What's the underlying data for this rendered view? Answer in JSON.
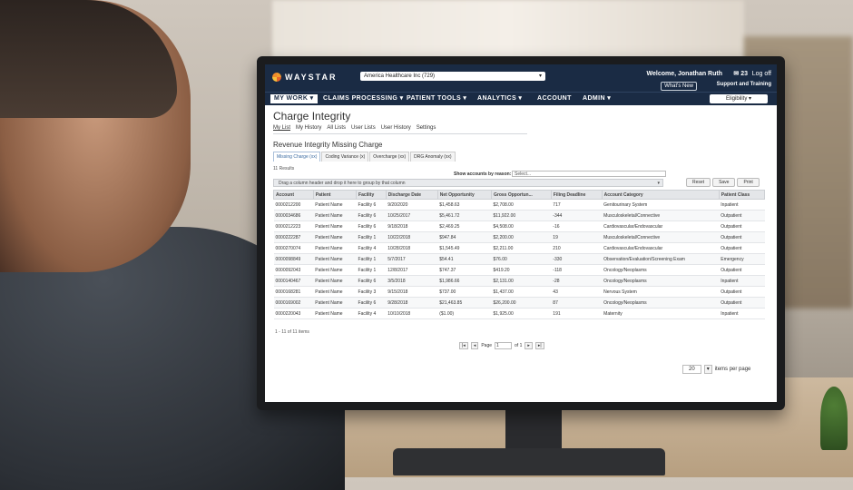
{
  "header": {
    "brand": "WAYSTAR",
    "org_select": "America Healthcare Inc (729)",
    "welcome": "Welcome, Jonathan Ruth",
    "mail_count": "23",
    "logoff": "Log off",
    "whats_new": "What's New",
    "support": "Support and Training",
    "eligibility": "Eligibility"
  },
  "nav": {
    "items": [
      "MY WORK",
      "CLAIMS PROCESSING",
      "PATIENT TOOLS",
      "ANALYTICS",
      "ACCOUNT",
      "ADMIN"
    ]
  },
  "page": {
    "title": "Charge Integrity",
    "subnav": [
      "My List",
      "My History",
      "All Lists",
      "User Lists",
      "User History",
      "Settings"
    ],
    "section_title": "Revenue Integrity Missing Charge",
    "tabs": [
      "Missing Charge (xx)",
      "Coding Variance (x)",
      "Overcharge (xx)",
      "DRG Anomaly (xx)"
    ],
    "results": "11 Results",
    "reason_label": "Show accounts by reason:",
    "reason_placeholder": "Select...",
    "group_hint": "Drag a column header and drop it here to group by that column",
    "buttons": [
      "Reset",
      "Save",
      "Print"
    ]
  },
  "table": {
    "columns": [
      "Account",
      "Patient",
      "Facility",
      "Discharge Date",
      "Net Opportunity",
      "Gross Opportun...",
      "Filing Deadline",
      "Account Category",
      "Patient Class"
    ],
    "rows": [
      [
        "0000212200",
        "Patient Name",
        "Facility 6",
        "9/20/2020",
        "$1,458.63",
        "$2,708.00",
        "717",
        "Genitourinary System",
        "Inpatient"
      ],
      [
        "0000034686",
        "Patient Name",
        "Facility 6",
        "10/25/2017",
        "$5,461.72",
        "$11,922.00",
        "-344",
        "Musculoskeletal/Connective",
        "Outpatient"
      ],
      [
        "0000212223",
        "Patient Name",
        "Facility 6",
        "9/18/2018",
        "$2,469.25",
        "$4,508.00",
        "-16",
        "Cardiovascular/Endovascular",
        "Outpatient"
      ],
      [
        "0000222287",
        "Patient Name",
        "Facility 1",
        "10/22/2018",
        "$947.84",
        "$2,200.00",
        "19",
        "Musculoskeletal/Connective",
        "Outpatient"
      ],
      [
        "0000270074",
        "Patient Name",
        "Facility 4",
        "10/28/2018",
        "$1,545.49",
        "$2,211.00",
        "210",
        "Cardiovascular/Endovascular",
        "Outpatient"
      ],
      [
        "0000098849",
        "Patient Name",
        "Facility 1",
        "5/7/2017",
        "$54.41",
        "$76.00",
        "-330",
        "Observation/Evaluation/Screening Exam",
        "Emergency"
      ],
      [
        "0000092043",
        "Patient Name",
        "Facility 1",
        "12/8/2017",
        "$747.37",
        "$419.20",
        "-118",
        "Oncology/Neoplasms",
        "Outpatient"
      ],
      [
        "0000140467",
        "Patient Name",
        "Facility 6",
        "3/5/2018",
        "$1,986.66",
        "$2,131.00",
        "-28",
        "Oncology/Neoplasms",
        "Inpatient"
      ],
      [
        "0000168281",
        "Patient Name",
        "Facility 3",
        "9/15/2018",
        "$737.00",
        "$1,437.00",
        "43",
        "Nervous System",
        "Outpatient"
      ],
      [
        "0000169002",
        "Patient Name",
        "Facility 6",
        "9/28/2018",
        "$21,463.85",
        "$26,200.00",
        "87",
        "Oncology/Neoplasms",
        "Outpatient"
      ],
      [
        "0000220043",
        "Patient Name",
        "Facility 4",
        "10/10/2018",
        "($1.00)",
        "$1,925.00",
        "191",
        "Maternity",
        "Inpatient"
      ]
    ],
    "footer": "1 - 11 of 11 items"
  },
  "pager": {
    "page_label": "Page",
    "page_value": "1",
    "of_label": "of 1",
    "per_page": "20",
    "per_page_label": "items per page"
  }
}
